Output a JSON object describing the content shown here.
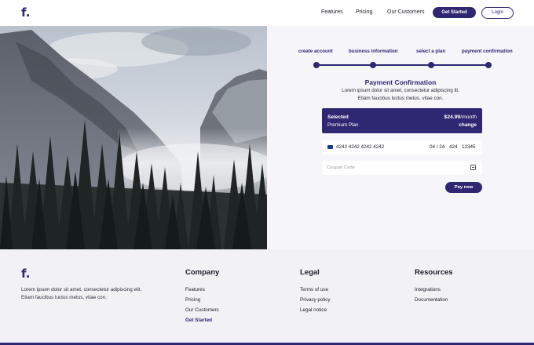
{
  "header": {
    "logo": "f.",
    "nav": [
      "Features",
      "Pricing",
      "Our Customers"
    ],
    "get_started": "Get Started",
    "login": "Login"
  },
  "hero": {
    "image": "misty-mountain-forest-photo"
  },
  "checkout": {
    "steps": [
      "create account",
      "business information",
      "select a plan",
      "payment confirmation"
    ],
    "title": "Payment Confirmation",
    "desc_line1": "Lorem ipsum dolor sit amet, consectetur adipiscing lit.",
    "desc_line2": "Etiam faucibus luctus metus, vitae con.",
    "plan": {
      "selected_label": "Selected",
      "name": "Premium Plan",
      "price": "$24.99",
      "period": "/month",
      "change": "change"
    },
    "card": {
      "brand": "VISA",
      "number": "4242 4242 4242 4242",
      "expiry": "04 / 24",
      "cvc": "424",
      "zip": "12345"
    },
    "coupon": {
      "placeholder": "Coupon Code",
      "value": ""
    },
    "pay_label": "Pay now"
  },
  "footer": {
    "logo": "f.",
    "desc": "Lorem ipsum dolor sit amet, consectetur adipiscing elit. Etiam faucibus luctus metus, vitae con.",
    "columns": [
      {
        "heading": "Company",
        "links": [
          "Features",
          "Pricing",
          "Our Customers",
          "Get Started"
        ]
      },
      {
        "heading": "Legal",
        "links": [
          "Terms of use",
          "Privacy policy",
          "Legal notice"
        ]
      },
      {
        "heading": "Resources",
        "links": [
          "Integrations",
          "Documentation"
        ]
      }
    ]
  },
  "colors": {
    "accent": "#2e2872",
    "background": "#f4f3f8",
    "panel": "#f6f5fa"
  }
}
